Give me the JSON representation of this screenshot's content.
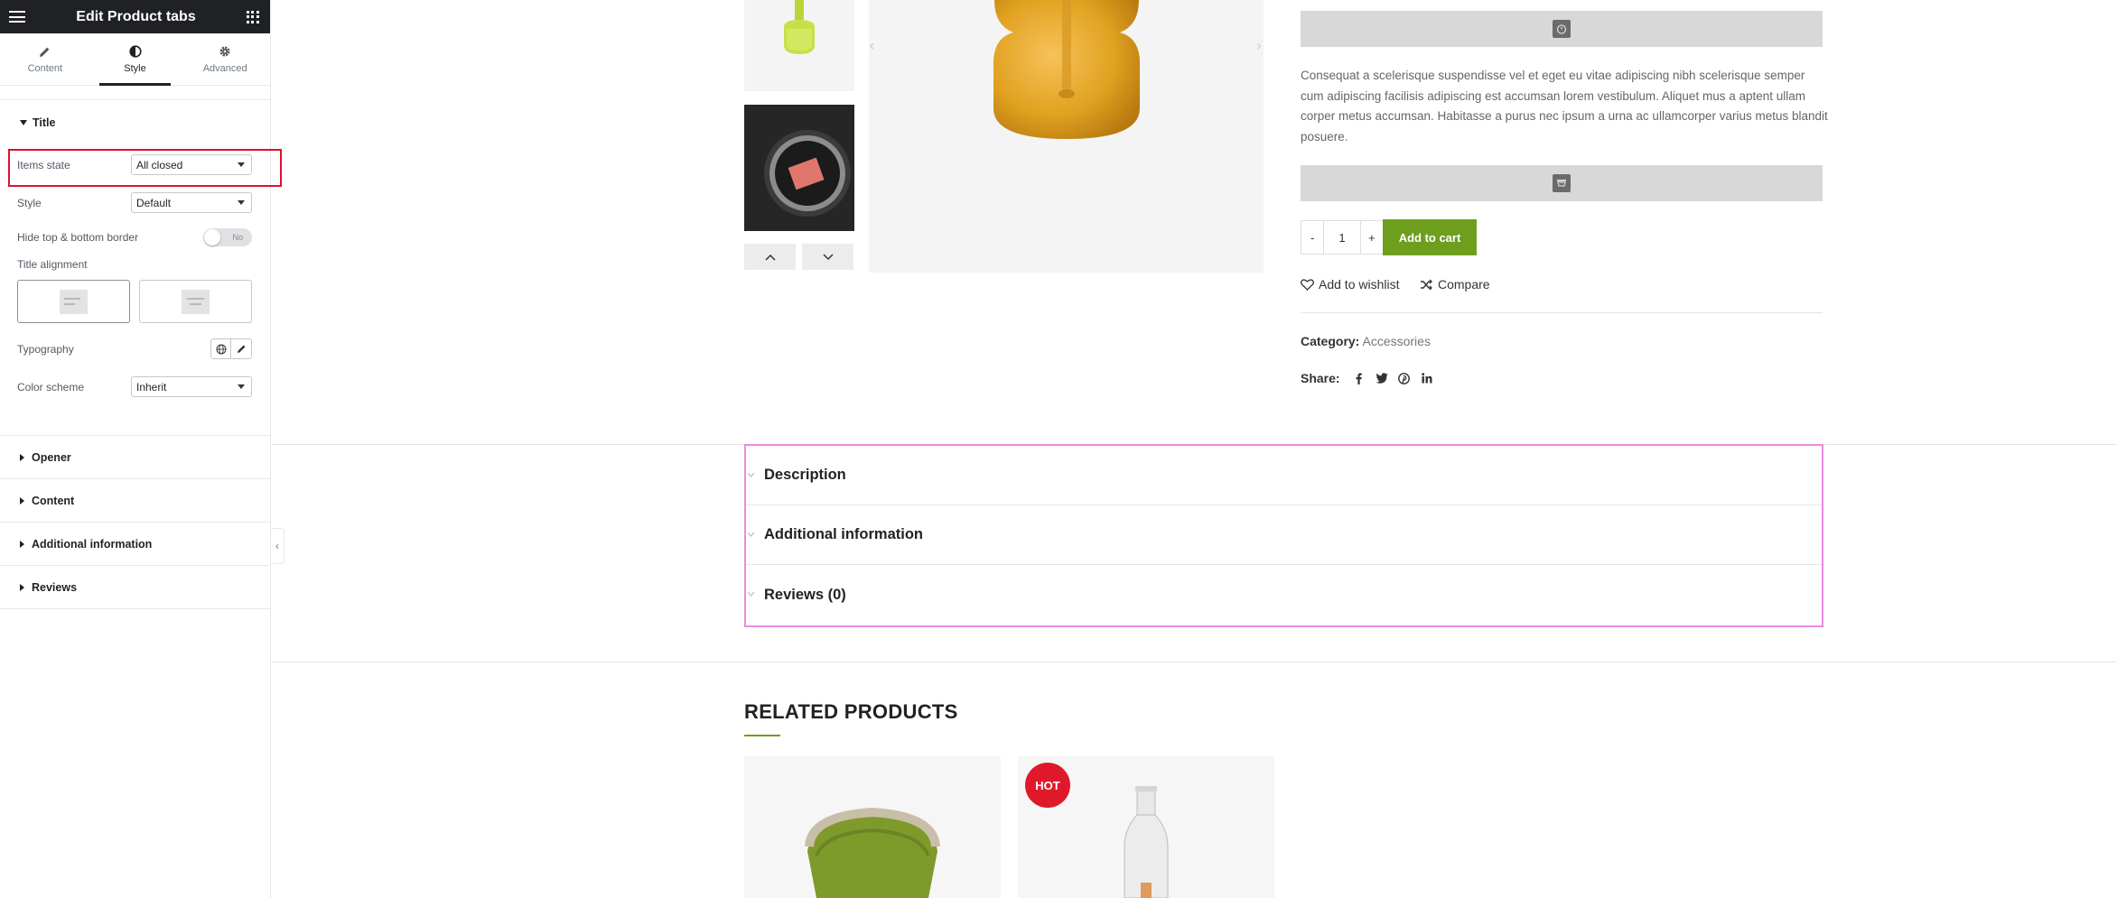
{
  "editor": {
    "title": "Edit Product tabs",
    "tabs": [
      {
        "label": "Content",
        "icon": "pencil-icon"
      },
      {
        "label": "Style",
        "icon": "half-circle-icon"
      },
      {
        "label": "Advanced",
        "icon": "gear-icon"
      }
    ],
    "active_tab": "Style",
    "title_section": {
      "label": "Title",
      "items_state": {
        "label": "Items state",
        "value": "All closed"
      },
      "style": {
        "label": "Style",
        "value": "Default"
      },
      "hide_border": {
        "label": "Hide top & bottom border",
        "value": "No"
      },
      "title_alignment": {
        "label": "Title alignment"
      },
      "typography": {
        "label": "Typography"
      },
      "color_scheme": {
        "label": "Color scheme",
        "value": "Inherit"
      }
    },
    "sections": [
      "Opener",
      "Content",
      "Additional information",
      "Reviews"
    ],
    "collapse_glyph": "‹"
  },
  "product": {
    "description": "Consequat a scelerisque suspendisse vel et eget eu vitae adipiscing nibh scelerisque semper cum adipiscing facilisis adipiscing est accumsan lorem vestibulum. Aliquet mus a aptent ullam corper metus accumsan. Habitasse a purus nec ipsum a urna ac ullamcorper varius metus blandit posuere.",
    "qty": {
      "minus": "-",
      "value": "1",
      "plus": "+"
    },
    "add_to_cart": "Add to cart",
    "wishlist": "Add to wishlist",
    "compare": "Compare",
    "category_label": "Category:",
    "category_value": "Accessories",
    "share_label": "Share:",
    "share_icons": [
      "facebook-icon",
      "twitter-icon",
      "pinterest-icon",
      "linkedin-icon"
    ]
  },
  "accordion": [
    "Description",
    "Additional information",
    "Reviews (0)"
  ],
  "related": {
    "heading": "RELATED PRODUCTS",
    "badge": "HOT"
  },
  "colors": {
    "accent_green": "#6e9e1e",
    "highlight_red": "#e0102a",
    "selection_pink": "#e98ae3",
    "editor_dark": "#1f2124"
  }
}
